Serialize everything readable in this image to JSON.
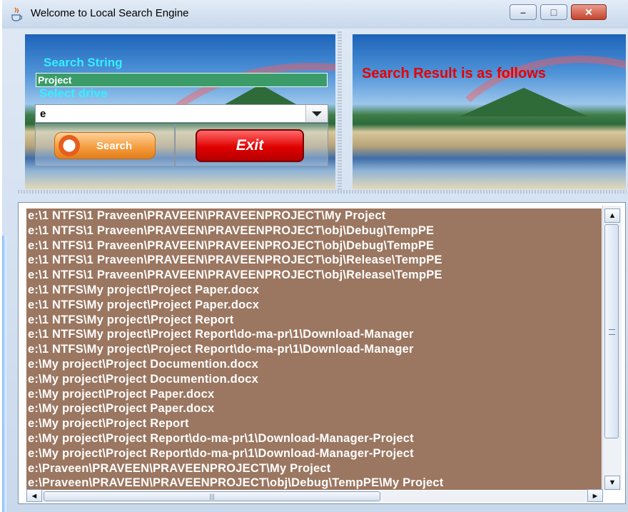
{
  "window": {
    "title": "Welcome to Local Search Engine",
    "controls": {
      "minimize": "–",
      "maximize": "□",
      "close": "✕"
    }
  },
  "left_panel": {
    "search_label": "Search String",
    "search_value": "Project",
    "drive_label": "Select drive",
    "drive_value": "e",
    "search_button": "Search",
    "exit_button": "Exit"
  },
  "right_panel": {
    "result_title": "Search Result is as follows"
  },
  "results": [
    "e:\\1 NTFS\\1 Praveen\\PRAVEEN\\PRAVEENPROJECT\\My Project",
    "e:\\1 NTFS\\1 Praveen\\PRAVEEN\\PRAVEENPROJECT\\obj\\Debug\\TempPE",
    "e:\\1 NTFS\\1 Praveen\\PRAVEEN\\PRAVEENPROJECT\\obj\\Debug\\TempPE",
    "e:\\1 NTFS\\1 Praveen\\PRAVEEN\\PRAVEENPROJECT\\obj\\Release\\TempPE",
    "e:\\1 NTFS\\1 Praveen\\PRAVEEN\\PRAVEENPROJECT\\obj\\Release\\TempPE",
    "e:\\1 NTFS\\My project\\Project Paper.docx",
    "e:\\1 NTFS\\My project\\Project Paper.docx",
    "e:\\1 NTFS\\My project\\Project Report",
    "e:\\1 NTFS\\My project\\Project Report\\do-ma-pr\\1\\Download-Manager",
    "e:\\1 NTFS\\My project\\Project Report\\do-ma-pr\\1\\Download-Manager",
    "e:\\My project\\Project Documention.docx",
    "e:\\My project\\Project Documention.docx",
    "e:\\My project\\Project Paper.docx",
    "e:\\My project\\Project Paper.docx",
    "e:\\My project\\Project Report",
    "e:\\My project\\Project Report\\do-ma-pr\\1\\Download-Manager-Project",
    "e:\\My project\\Project Report\\do-ma-pr\\1\\Download-Manager-Project",
    "e:\\Praveen\\PRAVEEN\\PRAVEENPROJECT\\My Project",
    "e:\\Praveen\\PRAVEEN\\PRAVEENPROJECT\\obj\\Debug\\TempPE\\My Project"
  ],
  "scrollbars": {
    "up": "▲",
    "down": "▼",
    "left": "◄",
    "right": "►",
    "grip": "|||"
  },
  "colors": {
    "list_background": "#9b7660",
    "label_cyan": "#35f0ff",
    "result_title_red": "#e60000",
    "search_field_green": "#3b9c6a",
    "exit_red": "#e00000",
    "search_orange": "#f39a3a"
  },
  "icons": {
    "app": "java-cup-icon",
    "search": "magnifier-icon",
    "dropdown": "chevron-down-icon"
  }
}
